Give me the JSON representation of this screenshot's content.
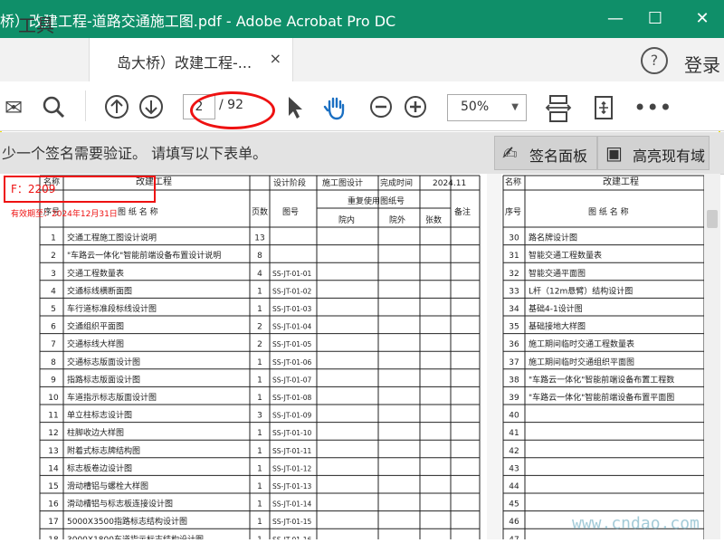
{
  "app": {
    "title": "桥）改建工程-道路交通施工图.pdf - Adobe Acrobat Pro DC",
    "window_controls": [
      "—",
      "☐",
      "✕"
    ]
  },
  "tabs": {
    "tools_label": "工具",
    "document_label": "岛大桥）改建工程-...",
    "close_glyph": "×",
    "help_glyph": "?",
    "login_label": "登录"
  },
  "toolbar": {
    "page_value": "2",
    "page_total": "/ 92",
    "zoom_value": "50%"
  },
  "signature_bar": {
    "message": "少一个签名需要验证。 请填写以下表单。",
    "panel_button": "签名面板",
    "highlight_button": "高亮现有域"
  },
  "document": {
    "stamp_left": "F：2209",
    "stamp_right": "有效期至：2024年12月31日",
    "header": {
      "project_label": "名称",
      "project_value": "改建工程",
      "stage_label": "设计阶段",
      "stage_value": "施工图设计",
      "finish_label": "完成时间",
      "finish_value": "2024.11",
      "reuse_label": "重复使用图纸号",
      "cols": [
        "序号",
        "图 纸 名 称",
        "页数",
        "图号",
        "院内",
        "院外",
        "张数",
        "备注"
      ]
    },
    "left_rows": [
      {
        "no": "1",
        "name": "交通工程施工图设计说明",
        "pages": "13",
        "code": ""
      },
      {
        "no": "2",
        "name": "\"车路云一体化\"智能前端设备布置设计说明",
        "pages": "8",
        "code": ""
      },
      {
        "no": "3",
        "name": "交通工程数量表",
        "pages": "4",
        "code": "SS-JT-01-01"
      },
      {
        "no": "4",
        "name": "交通标线横断面图",
        "pages": "1",
        "code": "SS-JT-01-02"
      },
      {
        "no": "5",
        "name": "车行道标准段标线设计图",
        "pages": "1",
        "code": "SS-JT-01-03"
      },
      {
        "no": "6",
        "name": "交通组织平面图",
        "pages": "2",
        "code": "SS-JT-01-04"
      },
      {
        "no": "7",
        "name": "交通标线大样图",
        "pages": "2",
        "code": "SS-JT-01-05"
      },
      {
        "no": "8",
        "name": "交通标志版面设计图",
        "pages": "1",
        "code": "SS-JT-01-06"
      },
      {
        "no": "9",
        "name": "指路标志版面设计图",
        "pages": "1",
        "code": "SS-JT-01-07"
      },
      {
        "no": "10",
        "name": "车道指示标志版面设计图",
        "pages": "1",
        "code": "SS-JT-01-08"
      },
      {
        "no": "11",
        "name": "单立柱标志设计图",
        "pages": "3",
        "code": "SS-JT-01-09"
      },
      {
        "no": "12",
        "name": "柱脚收边大样图",
        "pages": "1",
        "code": "SS-JT-01-10"
      },
      {
        "no": "13",
        "name": "附着式标志牌结构图",
        "pages": "1",
        "code": "SS-JT-01-11"
      },
      {
        "no": "14",
        "name": "标志板卷边设计图",
        "pages": "1",
        "code": "SS-JT-01-12"
      },
      {
        "no": "15",
        "name": "滑动槽铝与螺栓大样图",
        "pages": "1",
        "code": "SS-JT-01-13"
      },
      {
        "no": "16",
        "name": "滑动槽铝与标志板连接设计图",
        "pages": "1",
        "code": "SS-JT-01-14"
      },
      {
        "no": "17",
        "name": "5000X3500指路标志结构设计图",
        "pages": "1",
        "code": "SS-JT-01-15"
      },
      {
        "no": "18",
        "name": "3000X1800车道指示标志结构设计图",
        "pages": "1",
        "code": "SS-JT-01-16"
      }
    ],
    "right_header": {
      "project_label": "名称",
      "project_value": "改建工程",
      "no_label": "序号",
      "name_label": "图 纸 名 称"
    },
    "right_rows": [
      {
        "no": "30",
        "name": "路名牌设计图"
      },
      {
        "no": "31",
        "name": "智能交通工程数量表"
      },
      {
        "no": "32",
        "name": "智能交通平面图"
      },
      {
        "no": "33",
        "name": "L杆（12m悬臂）结构设计图"
      },
      {
        "no": "34",
        "name": "基础4-1设计图"
      },
      {
        "no": "35",
        "name": "基础接地大样图"
      },
      {
        "no": "36",
        "name": "施工期间临时交通工程数量表"
      },
      {
        "no": "37",
        "name": "施工期间临时交通组织平面图"
      },
      {
        "no": "38",
        "name": "\"车路云一体化\"智能前端设备布置工程数"
      },
      {
        "no": "39",
        "name": "\"车路云一体化\"智能前端设备布置平面图"
      },
      {
        "no": "40",
        "name": ""
      },
      {
        "no": "41",
        "name": ""
      },
      {
        "no": "42",
        "name": ""
      },
      {
        "no": "43",
        "name": ""
      },
      {
        "no": "44",
        "name": ""
      },
      {
        "no": "45",
        "name": ""
      },
      {
        "no": "46",
        "name": ""
      },
      {
        "no": "47",
        "name": ""
      }
    ]
  },
  "watermark": "www.cndao.com",
  "colors": {
    "titlebar": "#0f8f69",
    "annotation_red": "#e11111",
    "frame_yellow": "#f2e100"
  }
}
